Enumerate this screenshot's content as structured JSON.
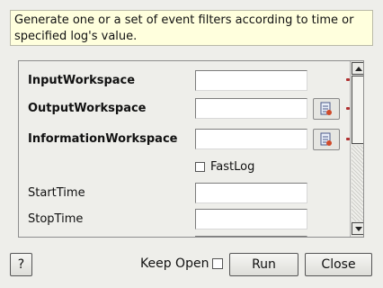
{
  "description": "Generate one or a set of event filters according to time or specified log's value.",
  "properties": [
    {
      "label": "InputWorkspace",
      "value": ""
    },
    {
      "label": "OutputWorkspace",
      "value": ""
    },
    {
      "label": "InformationWorkspace",
      "value": ""
    },
    {
      "label": "StartTime",
      "value": ""
    },
    {
      "label": "StopTime",
      "value": ""
    }
  ],
  "fastlog": {
    "label": "FastLog",
    "checked": false
  },
  "footer": {
    "help_label": "?",
    "keep_open_label": "Keep Open",
    "keep_open_checked": false,
    "run_label": "Run",
    "close_label": "Close"
  },
  "icons": {
    "browse": "workspace-browse-icon",
    "scroll_up": "arrow-up-icon",
    "scroll_down": "arrow-down-icon"
  }
}
